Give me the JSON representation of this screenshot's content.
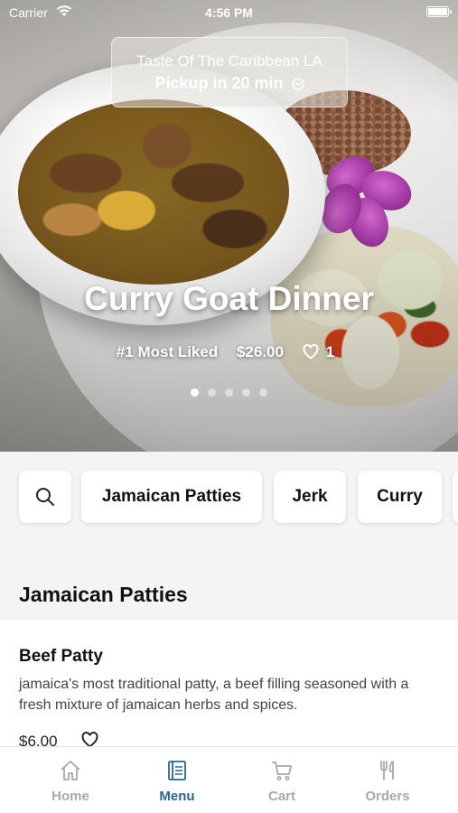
{
  "status_bar": {
    "carrier": "Carrier",
    "time": "4:56 PM"
  },
  "store": {
    "name": "Taste Of The Caribbean LA",
    "pickup": "Pickup in 20 min"
  },
  "featured": {
    "title": "Curry Goat Dinner",
    "rank": "#1 Most Liked",
    "price": "$26.00",
    "likes": "1",
    "slides_total": 5,
    "active_slide": 1
  },
  "categories": [
    "Jamaican Patties",
    "Jerk",
    "Curry"
  ],
  "section": {
    "title": "Jamaican Patties",
    "items": [
      {
        "name": "Beef Patty",
        "description": "jamaica's most traditional patty, a beef filling seasoned with a fresh mixture of jamaican herbs and spices.",
        "price": "$6.00"
      }
    ]
  },
  "tabs": [
    {
      "label": "Home",
      "icon": "home-icon",
      "active": false
    },
    {
      "label": "Menu",
      "icon": "menu-icon",
      "active": true
    },
    {
      "label": "Cart",
      "icon": "cart-icon",
      "active": false
    },
    {
      "label": "Orders",
      "icon": "utensils-icon",
      "active": false
    }
  ],
  "colors": {
    "accent": "#2a6690",
    "inactive_tab": "#a8a8a8"
  }
}
